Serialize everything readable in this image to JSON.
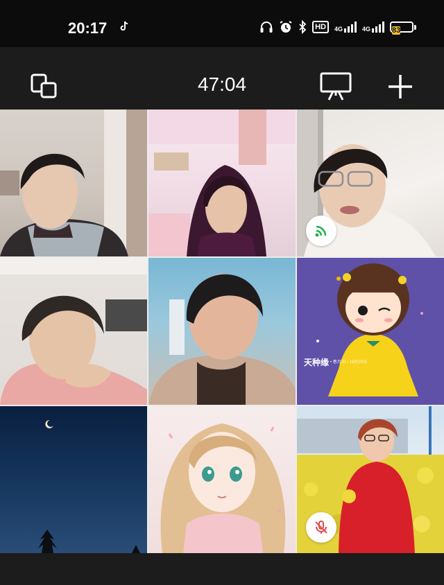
{
  "status_bar": {
    "time": "20:17",
    "notification_icon": "tiktok-icon",
    "icons": [
      "headphones-icon",
      "alarm-icon",
      "bluetooth-icon",
      "hd-icon",
      "signal-4g-icon",
      "signal-4g-icon",
      "battery-icon"
    ],
    "hd_label": "HD",
    "network_1": "4G",
    "network_2": "4G",
    "battery_level": "83",
    "battery_color": "#f2c230"
  },
  "toolbar": {
    "timer": "47:04",
    "icons": [
      "switch-camera-icon",
      "screen-share-icon",
      "add-icon"
    ]
  },
  "participants": [
    {
      "tile": 1,
      "kind": "video",
      "scene": "woman-dark-hair-indoor"
    },
    {
      "tile": 2,
      "kind": "video",
      "scene": "woman-long-hair-pink-room"
    },
    {
      "tile": 3,
      "kind": "video",
      "scene": "woman-glasses-speaking",
      "status_icon": "speaking-icon"
    },
    {
      "tile": 4,
      "kind": "video",
      "scene": "woman-short-hair-pink-sweater"
    },
    {
      "tile": 5,
      "kind": "video",
      "scene": "woman-fur-coat-blue-wall"
    },
    {
      "tile": 6,
      "kind": "avatar",
      "scene": "cartoon-girl-yellow-dress",
      "watermark": "天种缘",
      "watermark_sub": "• 春月20 • 16月20日"
    },
    {
      "tile": 7,
      "kind": "avatar",
      "scene": "night-sky-crescent-moon"
    },
    {
      "tile": 8,
      "kind": "avatar",
      "scene": "anime-girl-blonde"
    },
    {
      "tile": 9,
      "kind": "avatar",
      "scene": "woman-red-jacket-rapeseed-field",
      "status_icon": "mic-muted-icon"
    }
  ],
  "colors": {
    "background": "#1c1c1c",
    "speaking": "#23b14d",
    "muted": "#e24a4a"
  }
}
